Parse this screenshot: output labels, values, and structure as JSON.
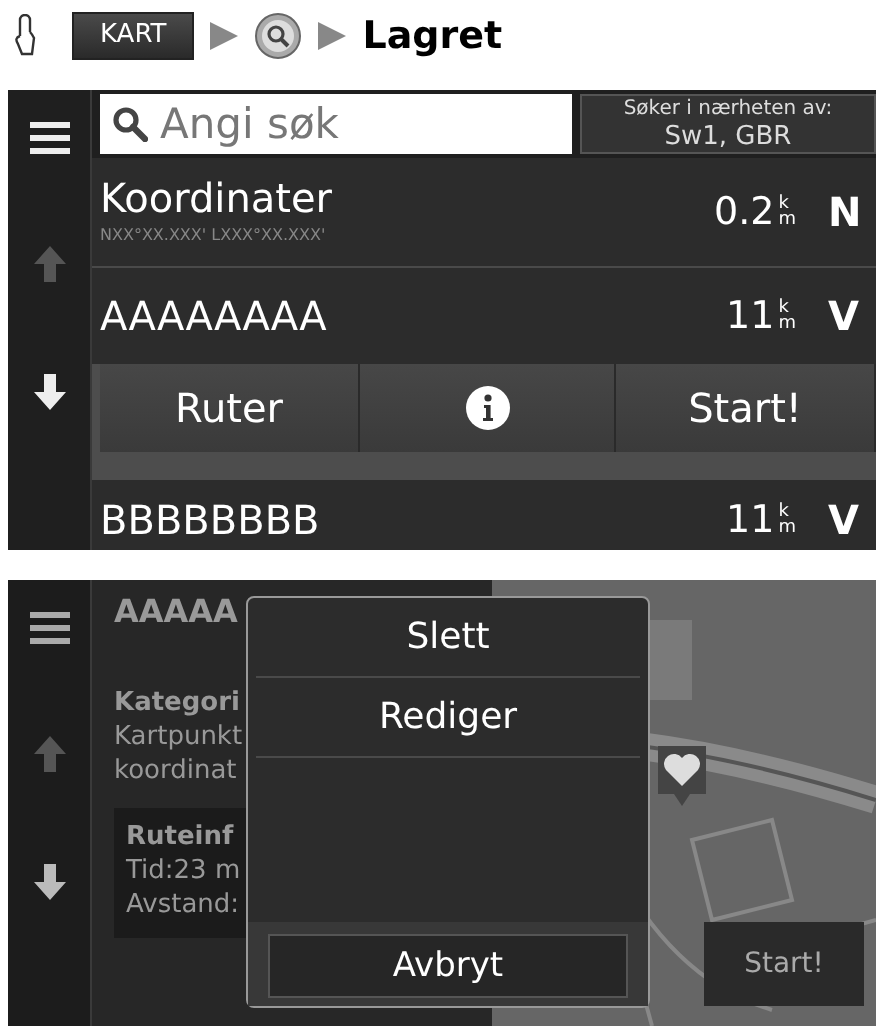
{
  "breadcrumb": {
    "steps": [
      {
        "kind": "button",
        "label": "KART"
      },
      {
        "kind": "search"
      },
      {
        "kind": "text",
        "label": "Lagret"
      }
    ]
  },
  "list_screen": {
    "scroll": {
      "up_disabled": true,
      "down_disabled": false
    },
    "search": {
      "placeholder": "Angi søk"
    },
    "nearby": {
      "label": "Søker i nærheten av:",
      "value": "Sw1, GBR"
    },
    "items": [
      {
        "name": "Koordinater",
        "subtitle": "NXX°XX.XXX' LXXX°XX.XXX'",
        "distance": "0.2",
        "unit_top": "k",
        "unit_bottom": "m",
        "direction": "N",
        "expanded": false
      },
      {
        "name": "AAAAAAAA",
        "distance": "11",
        "unit_top": "k",
        "unit_bottom": "m",
        "direction": "V",
        "expanded": true
      },
      {
        "name": "BBBBBBBB",
        "distance": "11",
        "unit_top": "k",
        "unit_bottom": "m",
        "direction": "V",
        "expanded": false
      }
    ],
    "actions": [
      {
        "kind": "text",
        "label": "Ruter"
      },
      {
        "kind": "info"
      },
      {
        "kind": "text",
        "label": "Start!"
      }
    ]
  },
  "detail_screen": {
    "scroll": {
      "up_disabled": true,
      "down_disabled": false
    },
    "title": "AAAAA",
    "category_label": "Kategori",
    "category_lines": [
      "Kartpunkt",
      "koordinat"
    ],
    "route_info": {
      "title": "Ruteinf",
      "lines": [
        "Tid:23 m",
        "Avstand:"
      ]
    },
    "map_button": "Start!",
    "menu": {
      "items": [
        "Slett",
        "Rediger"
      ],
      "cancel": "Avbryt"
    }
  }
}
